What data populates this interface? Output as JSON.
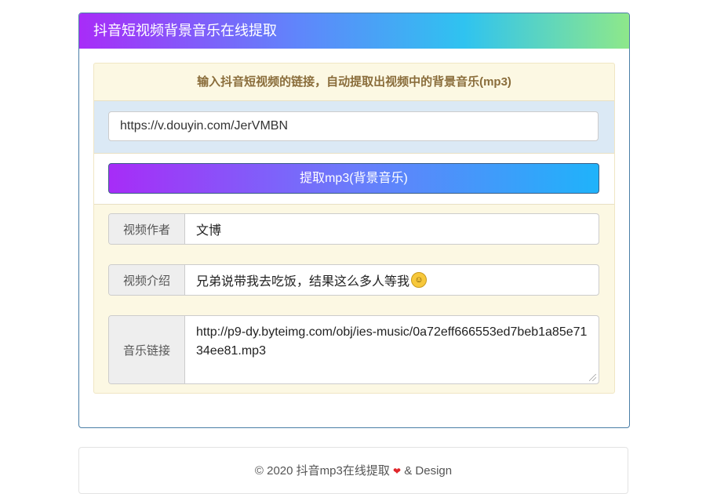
{
  "panel": {
    "title": "抖音短视频背景音乐在线提取",
    "intro": "输入抖音短视频的链接，自动提取出视频中的背景音乐(mp3)",
    "url_input": {
      "value": "https://v.douyin.com/JerVMBN"
    },
    "extract_button": "提取mp3(背景音乐)",
    "fields": [
      {
        "label": "视频作者",
        "value": "文博"
      },
      {
        "label": "视频介绍",
        "value": "兄弟说带我去吃饭，结果这么多人等我",
        "emoji": "laughing-tears-emoji"
      },
      {
        "label": "音乐链接",
        "value": "http://p9-dy.byteimg.com/obj/ies-music/0a72eff666553ed7beb1a85e7134ee81.mp3"
      }
    ]
  },
  "footer": {
    "text_before": "© 2020  抖音mp3在线提取",
    "heart_icon": "heart-icon",
    "text_after": "& Design"
  },
  "colors": {
    "header_gradient": [
      "#a82cf8",
      "#5f86fb",
      "#2fc3f0",
      "#8ee88a"
    ],
    "button_gradient": [
      "#a72cf7",
      "#6a7cfb",
      "#1fb3fa"
    ],
    "intro_text": "#8a6d3b",
    "inner_background": "#fcf8e3",
    "url_row_background": "#dbe9f5"
  }
}
